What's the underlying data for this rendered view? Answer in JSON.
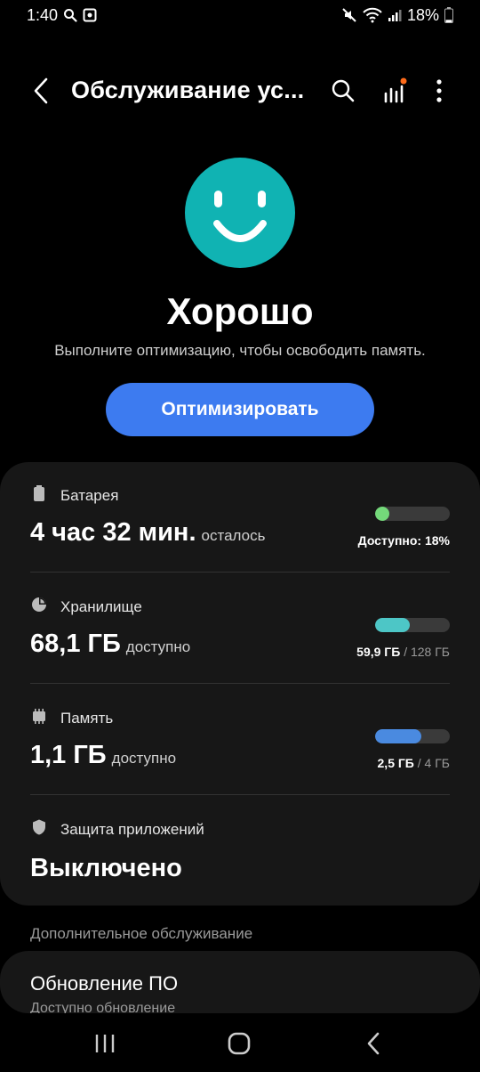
{
  "status_bar": {
    "time": "1:40",
    "battery_percent": "18%",
    "battery_level": 0.18,
    "icons": [
      "search-icon",
      "screenshot-icon",
      "mute-icon",
      "wifi-icon",
      "signal-icon",
      "battery-icon"
    ]
  },
  "app_bar": {
    "title": "Обслуживание ус...",
    "icons": [
      "back-icon",
      "search-icon",
      "stats-icon",
      "more-icon"
    ],
    "notification_dot_color": "#ff6b1a"
  },
  "hero": {
    "status_title": "Хорошо",
    "subtitle": "Выполните оптимизацию, чтобы освободить память.",
    "button_label": "Оптимизировать",
    "smiley_color": "#10b3b3",
    "button_color": "#3d7bf0"
  },
  "items": [
    {
      "label": "Батарея",
      "icon": "battery-icon",
      "value": "4 час 32 мин.",
      "value_suffix": "осталось",
      "caption_strong": "Доступно: 18%",
      "caption_muted": "",
      "level": 0.18,
      "bar_color": "#74d97a"
    },
    {
      "label": "Хранилище",
      "icon": "storage-pie-icon",
      "value": "68,1 ГБ",
      "value_suffix": "доступно",
      "caption_strong": "59,9 ГБ",
      "caption_muted": " / 128 ГБ",
      "level": 0.47,
      "bar_color": "#4dc6c6"
    },
    {
      "label": "Память",
      "icon": "memory-chip-icon",
      "value": "1,1 ГБ",
      "value_suffix": "доступно",
      "caption_strong": "2,5 ГБ",
      "caption_muted": " / 4 ГБ",
      "level": 0.62,
      "bar_color": "#4a8ae0"
    },
    {
      "label": "Защита приложений",
      "icon": "shield-icon",
      "value": "Выключено"
    }
  ],
  "extra": {
    "section_label": "Дополнительное обслуживание",
    "update_title": "Обновление ПО",
    "update_subtitle": "Доступно обновление"
  },
  "nav_bar": {
    "icons": [
      "recents-icon",
      "home-icon",
      "back-nav-icon"
    ]
  }
}
